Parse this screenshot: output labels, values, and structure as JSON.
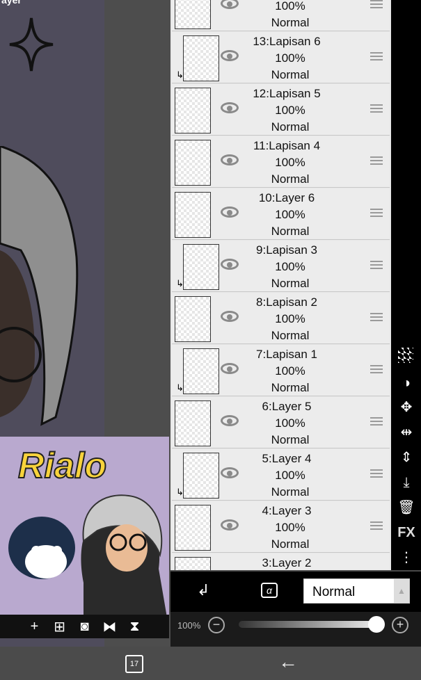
{
  "header": {
    "title_fragment": "ayer"
  },
  "preview": {
    "name": "Rialo",
    "toolbar_icons": [
      "plus-icon",
      "add-layer-icon",
      "camera-icon",
      "flip-horizontal-icon",
      "flip-vertical-icon"
    ]
  },
  "layers": [
    {
      "name": "",
      "opacity": "100%",
      "blend": "Normal",
      "clip": false,
      "partial": true
    },
    {
      "name": "13:Lapisan 6",
      "opacity": "100%",
      "blend": "Normal",
      "clip": true
    },
    {
      "name": "12:Lapisan 5",
      "opacity": "100%",
      "blend": "Normal",
      "clip": false
    },
    {
      "name": "11:Lapisan 4",
      "opacity": "100%",
      "blend": "Normal",
      "clip": false
    },
    {
      "name": "10:Layer 6",
      "opacity": "100%",
      "blend": "Normal",
      "clip": false
    },
    {
      "name": "9:Lapisan 3",
      "opacity": "100%",
      "blend": "Normal",
      "clip": true
    },
    {
      "name": "8:Lapisan 2",
      "opacity": "100%",
      "blend": "Normal",
      "clip": false
    },
    {
      "name": "7:Lapisan 1",
      "opacity": "100%",
      "blend": "Normal",
      "clip": true
    },
    {
      "name": "6:Layer 5",
      "opacity": "100%",
      "blend": "Normal",
      "clip": false
    },
    {
      "name": "5:Layer 4",
      "opacity": "100%",
      "blend": "Normal",
      "clip": true
    },
    {
      "name": "4:Layer 3",
      "opacity": "100%",
      "blend": "Normal",
      "clip": false
    },
    {
      "name": "3:Layer 2",
      "opacity": "",
      "blend": "",
      "clip": false,
      "partial": true
    }
  ],
  "side_tools": [
    "checker-icon",
    "invert-icon",
    "move-icon",
    "flip-horizontal-icon",
    "flip-vertical-icon",
    "merge-down-icon",
    "trash-icon",
    "FX",
    "more-icon"
  ],
  "layer_bar": {
    "clip_icon": "↲",
    "lock_alpha_icon": "α",
    "blend_mode": "Normal",
    "blend_arrow": "▲"
  },
  "opacity_bar": {
    "label": "100%",
    "minus": "−",
    "plus": "+",
    "value": 1.0
  },
  "system_nav": {
    "recent_count": "17",
    "back_icon": "←"
  },
  "colors": {
    "accent": "#f8d33b",
    "list_bg": "#ececec",
    "toolbar_bg": "#000000"
  }
}
